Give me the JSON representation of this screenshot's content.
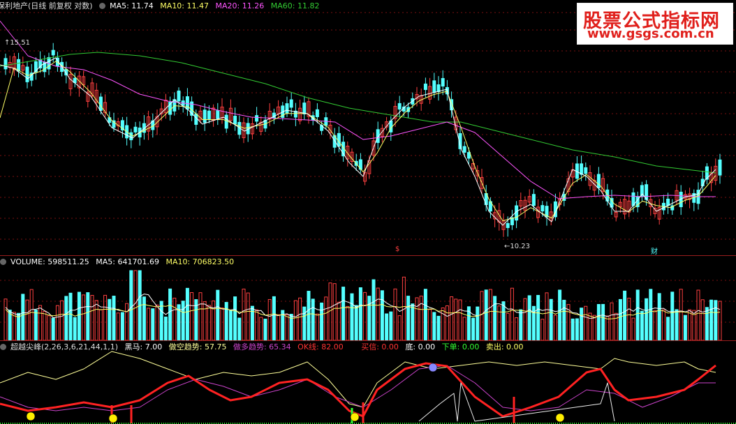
{
  "price_header": {
    "stock_title": "保利地产(日线 前复权 对数)",
    "ma5": "MA5: 11.74",
    "ma10": "MA10: 11.47",
    "ma20": "MA20: 11.26",
    "ma60": "MA60: 11.82"
  },
  "price_annotations": {
    "high_label": "15.51",
    "low_label": "10.23",
    "marker_s": "$",
    "marker_cai": "财"
  },
  "volume_header": {
    "volume": "VOLUME: 598511.25",
    "ma5": "MA5: 641701.69",
    "ma10": "MA10: 706823.50"
  },
  "indicator_header": {
    "name": "超越尖峰(2,26,3,6,21,44,1,1)",
    "heima": "黑马: 7.00",
    "zuokong": "做空趋势: 57.75",
    "zuoduo": "做多趋势: 65.34",
    "okxian": "OK线: 82.00",
    "mairu": "买信: 0.00",
    "di": "底: 0.00",
    "xiadan": "下单: 0.00",
    "maichu": "卖出: 0.00"
  },
  "watermark": {
    "line1": "股票公式指标网",
    "line2": "www.gsgs.com.cn"
  },
  "colors": {
    "up": "#ff4040",
    "down": "#54ffff",
    "ma5": "#ffffff",
    "ma10": "#ffff66",
    "ma20": "#ff55ff",
    "ma60": "#33cc33",
    "grid": "#7a1010"
  },
  "chart_data": [
    {
      "type": "candlestick",
      "title": "保利地产(日线 前复权 对数)",
      "series": [
        {
          "name": "MA5",
          "values": [
            11.74
          ]
        },
        {
          "name": "MA10",
          "values": [
            11.47
          ]
        },
        {
          "name": "MA20",
          "values": [
            11.26
          ]
        },
        {
          "name": "MA60",
          "values": [
            11.82
          ]
        }
      ],
      "annotations": [
        "15.51",
        "10.23"
      ]
    },
    {
      "type": "bar",
      "title": "VOLUME",
      "series": [
        {
          "name": "VOLUME",
          "values": [
            598511.25
          ]
        },
        {
          "name": "MA5",
          "values": [
            641701.69
          ]
        },
        {
          "name": "MA10",
          "values": [
            706823.5
          ]
        }
      ]
    },
    {
      "type": "line",
      "title": "超越尖峰(2,26,3,6,21,44,1,1)",
      "series": [
        {
          "name": "黑马",
          "values": [
            7.0
          ]
        },
        {
          "name": "做空趋势",
          "values": [
            57.75
          ]
        },
        {
          "name": "做多趋势",
          "values": [
            65.34
          ]
        },
        {
          "name": "OK线",
          "values": [
            82.0
          ]
        },
        {
          "name": "买信",
          "values": [
            0.0
          ]
        },
        {
          "name": "底",
          "values": [
            0.0
          ]
        },
        {
          "name": "下单",
          "values": [
            0.0
          ]
        },
        {
          "name": "卖出",
          "values": [
            0.0
          ]
        }
      ]
    }
  ]
}
